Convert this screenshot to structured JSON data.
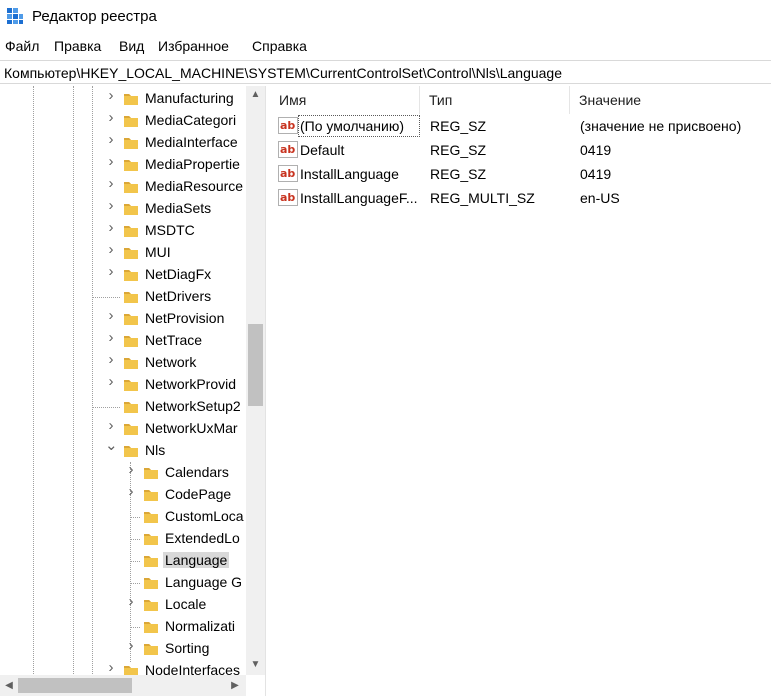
{
  "window": {
    "title": "Редактор реестра"
  },
  "menu": [
    "Файл",
    "Правка",
    "Вид",
    "Избранное",
    "Справка"
  ],
  "address": "Компьютер\\HKEY_LOCAL_MACHINE\\SYSTEM\\CurrentControlSet\\Control\\Nls\\Language",
  "tree": {
    "items": [
      {
        "label": "Manufacturing",
        "level": 1,
        "expander": "collapsed"
      },
      {
        "label": "MediaCategori",
        "level": 1,
        "expander": "collapsed"
      },
      {
        "label": "MediaInterface",
        "level": 1,
        "expander": "collapsed"
      },
      {
        "label": "MediaPropertie",
        "level": 1,
        "expander": "collapsed"
      },
      {
        "label": "MediaResource",
        "level": 1,
        "expander": "collapsed"
      },
      {
        "label": "MediaSets",
        "level": 1,
        "expander": "collapsed"
      },
      {
        "label": "MSDTC",
        "level": 1,
        "expander": "collapsed"
      },
      {
        "label": "MUI",
        "level": 1,
        "expander": "collapsed"
      },
      {
        "label": "NetDiagFx",
        "level": 1,
        "expander": "collapsed"
      },
      {
        "label": "NetDrivers",
        "level": 1,
        "expander": "none"
      },
      {
        "label": "NetProvision",
        "level": 1,
        "expander": "collapsed"
      },
      {
        "label": "NetTrace",
        "level": 1,
        "expander": "collapsed"
      },
      {
        "label": "Network",
        "level": 1,
        "expander": "collapsed"
      },
      {
        "label": "NetworkProvid",
        "level": 1,
        "expander": "collapsed"
      },
      {
        "label": "NetworkSetup2",
        "level": 1,
        "expander": "none"
      },
      {
        "label": "NetworkUxMar",
        "level": 1,
        "expander": "collapsed"
      },
      {
        "label": "Nls",
        "level": 1,
        "expander": "expanded"
      },
      {
        "label": "Calendars",
        "level": 2,
        "expander": "collapsed"
      },
      {
        "label": "CodePage",
        "level": 2,
        "expander": "collapsed"
      },
      {
        "label": "CustomLoca",
        "level": 2,
        "expander": "none"
      },
      {
        "label": "ExtendedLo",
        "level": 2,
        "expander": "none"
      },
      {
        "label": "Language",
        "level": 2,
        "expander": "none",
        "selected": true
      },
      {
        "label": "Language G",
        "level": 2,
        "expander": "none"
      },
      {
        "label": "Locale",
        "level": 2,
        "expander": "collapsed"
      },
      {
        "label": "Normalizati",
        "level": 2,
        "expander": "none"
      },
      {
        "label": "Sorting",
        "level": 2,
        "expander": "collapsed"
      },
      {
        "label": "NodeInterfaces",
        "level": 1,
        "expander": "collapsed"
      }
    ]
  },
  "list": {
    "columns": [
      "Имя",
      "Тип",
      "Значение"
    ],
    "rows": [
      {
        "name": "(По умолчанию)",
        "type": "REG_SZ",
        "value": "(значение не присвоено)"
      },
      {
        "name": "Default",
        "type": "REG_SZ",
        "value": "0419"
      },
      {
        "name": "InstallLanguage",
        "type": "REG_SZ",
        "value": "0419"
      },
      {
        "name": "InstallLanguageF...",
        "type": "REG_MULTI_SZ",
        "value": "en-US"
      }
    ],
    "value_icon": "ab-string-icon"
  },
  "colors": {
    "folder": "#f2c54b",
    "folder_dark": "#dba737",
    "selection": "#d9d9d9",
    "ab_red": "#c8321e"
  }
}
